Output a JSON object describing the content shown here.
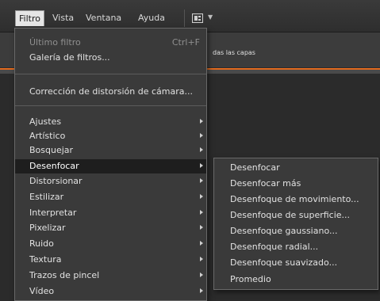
{
  "menubar": {
    "items": [
      {
        "label": "Filtro",
        "active": true
      },
      {
        "label": "Vista"
      },
      {
        "label": "Ventana"
      },
      {
        "label": "Ayuda"
      }
    ]
  },
  "options_bar": {
    "text": "das las capas"
  },
  "filter_menu": {
    "top": [
      {
        "label": "Último filtro",
        "shortcut": "Ctrl+F",
        "disabled": true
      },
      {
        "label": "Galería de filtros..."
      }
    ],
    "middle": [
      {
        "label": "Corrección de distorsión de cámara..."
      }
    ],
    "groups": [
      {
        "label": "Ajustes"
      },
      {
        "label": "Artístico"
      },
      {
        "label": "Bosquejar"
      },
      {
        "label": "Desenfocar",
        "selected": true
      },
      {
        "label": "Distorsionar"
      },
      {
        "label": "Estilizar"
      },
      {
        "label": "Interpretar"
      },
      {
        "label": "Pixelizar"
      },
      {
        "label": "Ruido"
      },
      {
        "label": "Textura"
      },
      {
        "label": "Trazos de pincel"
      },
      {
        "label": "Vídeo"
      }
    ]
  },
  "submenu_desenfocar": {
    "items": [
      {
        "label": "Desenfocar"
      },
      {
        "label": "Desenfocar más"
      },
      {
        "label": "Desenfoque de movimiento..."
      },
      {
        "label": "Desenfoque de superficie..."
      },
      {
        "label": "Desenfoque gaussiano..."
      },
      {
        "label": "Desenfoque radial..."
      },
      {
        "label": "Desenfoque suavizado..."
      },
      {
        "label": "Promedio"
      }
    ]
  },
  "icons": {
    "arrange": "arrange-documents-icon",
    "submenu_arrow": "submenu-arrow-icon",
    "dropdown": "dropdown-caret-icon"
  },
  "colors": {
    "menu_bg": "#3a3a3a",
    "highlight": "#1e1e1e",
    "accent_line": "#e26a1e"
  }
}
